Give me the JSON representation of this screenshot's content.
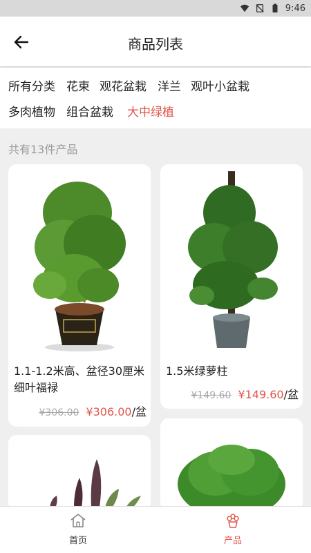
{
  "status": {
    "time": "9:46"
  },
  "header": {
    "title": "商品列表"
  },
  "filters": [
    {
      "label": "所有分类",
      "active": false
    },
    {
      "label": "花束",
      "active": false
    },
    {
      "label": "观花盆栽",
      "active": false
    },
    {
      "label": "洋兰",
      "active": false
    },
    {
      "label": "观叶小盆栽",
      "active": false
    },
    {
      "label": "多肉植物",
      "active": false
    },
    {
      "label": "组合盆栽",
      "active": false
    },
    {
      "label": "大中绿植",
      "active": true
    }
  ],
  "summary": {
    "count_text": "共有13件产品"
  },
  "products": [
    {
      "name": "1.1-1.2米高、盆径30厘米细叶福禄",
      "old_price": "¥306.00",
      "price": "¥306.00",
      "unit": "/盆"
    },
    {
      "name": "1.5米绿萝柱",
      "old_price": "¥149.60",
      "price": "¥149.60",
      "unit": "/盆"
    }
  ],
  "tabs": [
    {
      "label": "首页",
      "active": false
    },
    {
      "label": "产品",
      "active": true
    }
  ],
  "colors": {
    "accent": "#e2554a",
    "background": "#efefef"
  }
}
